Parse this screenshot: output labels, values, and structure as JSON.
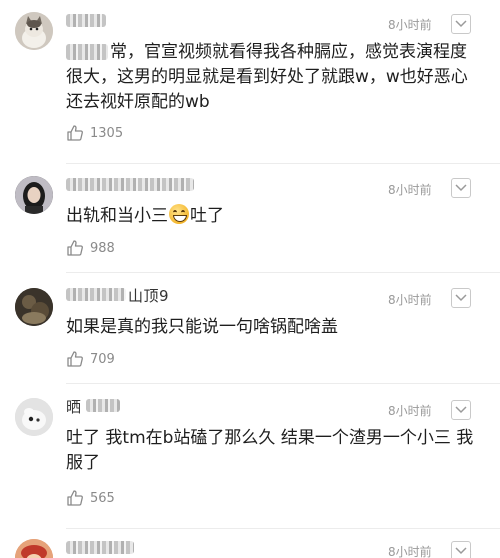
{
  "comments": [
    {
      "username": "",
      "time": "8小时前",
      "text": "常，官宣视频就看得我各种膈应，感觉表演程度很大，这男的明显就是看到好处了就跟w，w也好恶心还去视奸原配的wb",
      "likes": "1305",
      "avatar": "cat-avatar"
    },
    {
      "username": "",
      "time": "8小时前",
      "text_before": "出轨和当小三",
      "emoji": "grinning-sweat-emoji",
      "text_after": "吐了",
      "likes": "988",
      "avatar": "portrait-avatar"
    },
    {
      "username": "山顶9",
      "time": "8小时前",
      "text": "如果是真的我只能说一句啥锅配啥盖",
      "likes": "709",
      "avatar": "dark-avatar"
    },
    {
      "username": "晒",
      "time": "8小时前",
      "text": "吐了 我tm在b站磕了那么久 结果一个渣男一个小三 我服了",
      "likes": "565",
      "avatar": "animal-avatar"
    },
    {
      "username": "",
      "time": "8小时前",
      "avatar": "character-avatar"
    }
  ],
  "colors": {
    "text": "#1e1e1e",
    "meta": "#9a9a9a",
    "divider": "#ececec"
  }
}
